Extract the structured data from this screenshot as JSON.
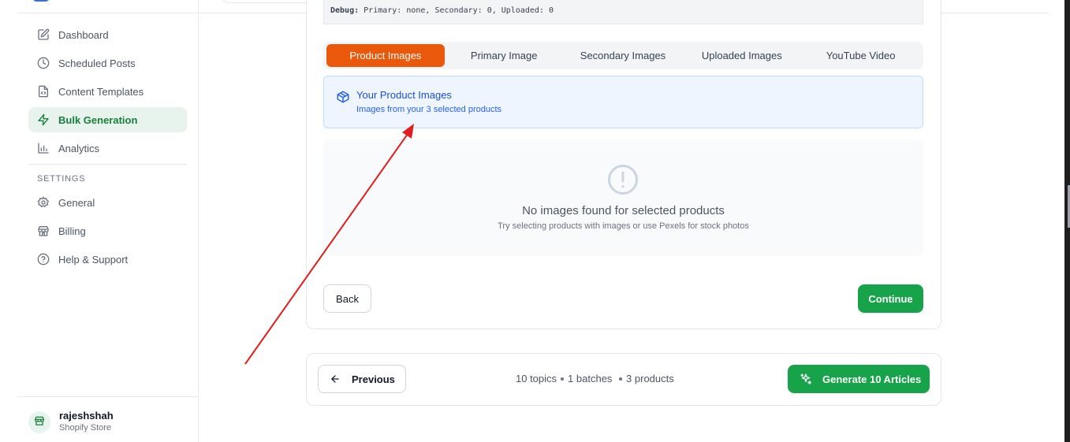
{
  "sidebar": {
    "items": [
      {
        "label": "Dashboard",
        "icon": "edit-icon"
      },
      {
        "label": "Scheduled Posts",
        "icon": "clock-icon"
      },
      {
        "label": "Content Templates",
        "icon": "file-code-icon"
      },
      {
        "label": "Bulk Generation",
        "icon": "bolt-icon",
        "active": true
      },
      {
        "label": "Analytics",
        "icon": "bar-chart-icon"
      }
    ],
    "settings_heading": "SETTINGS",
    "settings_items": [
      {
        "label": "General",
        "icon": "gear-icon"
      },
      {
        "label": "Billing",
        "icon": "store-icon"
      },
      {
        "label": "Help & Support",
        "icon": "help-circle-icon"
      }
    ],
    "user": {
      "name": "rajeshshah",
      "subtitle": "Shopify Store",
      "icon": "store-icon"
    }
  },
  "debug": {
    "label": "Debug:",
    "text": "Primary: none, Secondary: 0, Uploaded: 0"
  },
  "tabs": [
    {
      "label": "Product Images",
      "active": true
    },
    {
      "label": "Primary Image"
    },
    {
      "label": "Secondary Images"
    },
    {
      "label": "Uploaded Images"
    },
    {
      "label": "YouTube Video"
    }
  ],
  "info": {
    "title": "Your Product Images",
    "subtitle": "Images from your 3 selected products",
    "icon": "package-icon"
  },
  "empty_state": {
    "title": "No images found for selected products",
    "subtitle": "Try selecting products with images or use Pexels for stock photos",
    "icon": "alert-circle-icon"
  },
  "actions": {
    "back": "Back",
    "continue": "Continue"
  },
  "footer": {
    "previous": "Previous",
    "stats": {
      "topics": "10 topics",
      "batches": "1 batches",
      "products": "3 products"
    },
    "generate": "Generate 10 Articles"
  },
  "colors": {
    "accent": "#ea580c",
    "primary_green": "#16a34a",
    "active_nav_bg": "#e7f3ec",
    "info_blue": "#1d4ed8",
    "annotation_red": "#e11d1d"
  }
}
